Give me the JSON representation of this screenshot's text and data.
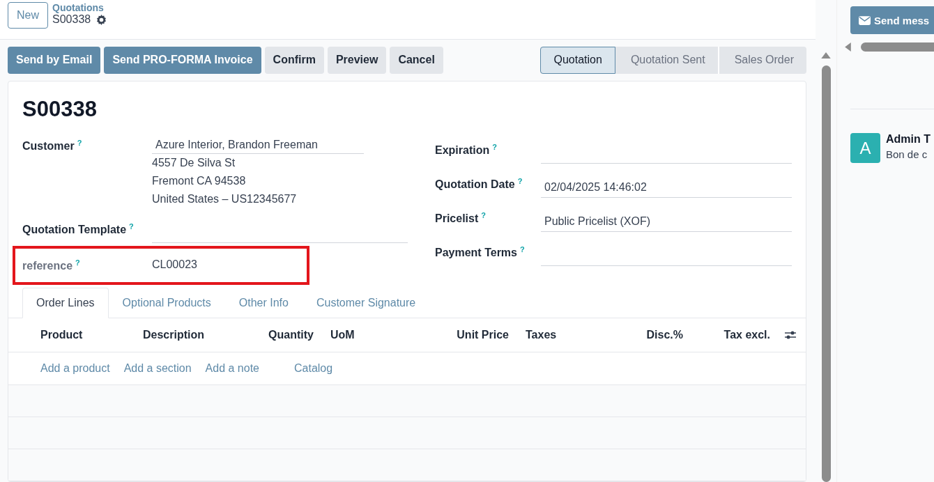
{
  "breadcrumb": {
    "new_button": "New",
    "parent": "Quotations",
    "current": "S00338"
  },
  "actions": [
    {
      "label": "Send by Email",
      "kind": "primary"
    },
    {
      "label": "Send PRO-FORMA Invoice",
      "kind": "primary"
    },
    {
      "label": "Confirm",
      "kind": "secondary"
    },
    {
      "label": "Preview",
      "kind": "secondary"
    },
    {
      "label": "Cancel",
      "kind": "secondary"
    }
  ],
  "status_steps": [
    {
      "label": "Quotation",
      "selected": true
    },
    {
      "label": "Quotation Sent",
      "selected": false
    },
    {
      "label": "Sales Order",
      "selected": false
    }
  ],
  "record_name": "S00338",
  "left_fields": [
    {
      "label": "Customer",
      "help": "?",
      "value": "Azure Interior, Brandon Freeman",
      "address_lines": [
        "4557 De Silva St",
        "Fremont CA 94538",
        "United States – US12345677"
      ],
      "highlighted": false,
      "kind": "input"
    },
    {
      "label": "Quotation Template",
      "help": "?",
      "highlighted": false,
      "kind": "input"
    },
    {
      "label": "reference",
      "help": "?",
      "value": "CL00023",
      "highlighted": true,
      "kind": "readonly"
    }
  ],
  "right_fields": [
    {
      "label": "Expiration",
      "help": "?"
    },
    {
      "label": "Quotation Date",
      "help": "?",
      "value": "02/04/2025 14:46:02"
    },
    {
      "label": "Pricelist",
      "help": "?",
      "value": "Public Pricelist (XOF)"
    },
    {
      "label": "Payment Terms",
      "help": "?"
    }
  ],
  "tabs": [
    {
      "label": "Order Lines",
      "selected": true
    },
    {
      "label": "Optional Products",
      "selected": false
    },
    {
      "label": "Other Info",
      "selected": false
    },
    {
      "label": "Customer Signature",
      "selected": false
    }
  ],
  "columns": [
    {
      "label": "Product",
      "kind": "text"
    },
    {
      "label": "Description",
      "kind": "text"
    },
    {
      "label": "Quantity",
      "kind": "number"
    },
    {
      "label": "UoM",
      "kind": "text"
    },
    {
      "label": "Unit Price",
      "kind": "number"
    },
    {
      "label": "Taxes",
      "kind": "text"
    },
    {
      "label": "Disc.%",
      "kind": "number"
    },
    {
      "label": "Tax excl.",
      "kind": "number"
    }
  ],
  "add_links": [
    "Add a product",
    "Add a section",
    "Add a note",
    "Catalog"
  ],
  "chatter": {
    "send_button": "Send mess",
    "avatar_letter": "A",
    "author": "Admin T",
    "message": "Bon de c"
  }
}
